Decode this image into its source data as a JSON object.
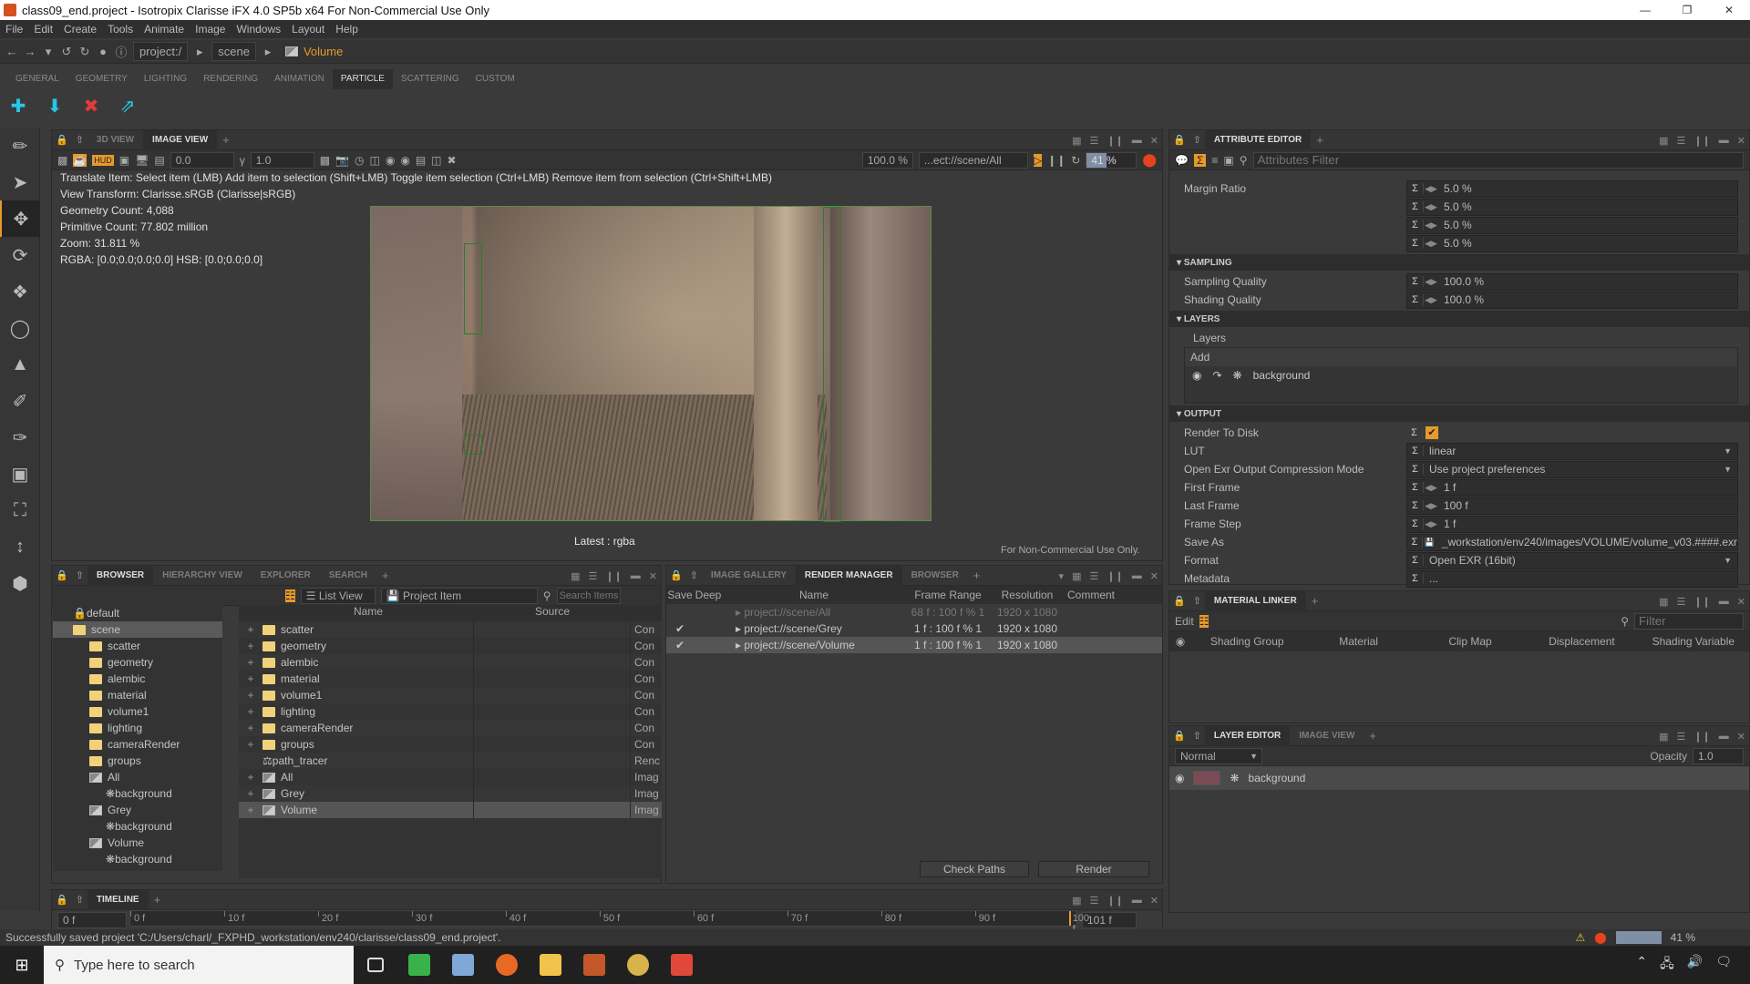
{
  "window": {
    "title": "class09_end.project - Isotropix Clarisse iFX 4.0 SP5b x64  For Non-Commercial Use Only",
    "controls": [
      "minimize",
      "maximize",
      "close"
    ]
  },
  "menu": [
    "File",
    "Edit",
    "Create",
    "Tools",
    "Animate",
    "Image",
    "Windows",
    "Layout",
    "Help"
  ],
  "breadcrumb": {
    "root": "project:/",
    "scene": "scene",
    "current": "Volume"
  },
  "shelf": {
    "tabs": [
      "GENERAL",
      "GEOMETRY",
      "LIGHTING",
      "RENDERING",
      "ANIMATION",
      "PARTICLE",
      "SCATTERING",
      "CUSTOM"
    ],
    "active_tab": "PARTICLE",
    "buttons": [
      "particle-add-icon",
      "particle-import-icon",
      "particle-remove-icon",
      "particle-scatter-icon"
    ]
  },
  "tools": [
    "eyedropper",
    "select",
    "translate",
    "rotate",
    "scale",
    "local-rotate",
    "stamp",
    "paint-scatter",
    "paint-list",
    "region-render",
    "frame-teapot",
    "measure",
    "color-swatch"
  ],
  "viewer": {
    "tabs": [
      "3D VIEW",
      "IMAGE VIEW"
    ],
    "active_tab": "IMAGE VIEW",
    "exposure": "0.0",
    "gamma": "1.0",
    "zoom_field": "100.0 %",
    "image_path": "...ect://scene/All",
    "progress": "41 %",
    "progress_value": 41,
    "hud": {
      "help": "Translate Item: Select item (LMB)  Add item to selection (Shift+LMB)  Toggle item selection (Ctrl+LMB)  Remove item from selection (Ctrl+Shift+LMB)",
      "view_transform": "View Transform: Clarisse.sRGB (Clarisse|sRGB)",
      "geometry_count": "Geometry Count: 4,088",
      "primitive_count": "Primitive Count: 77.802 million",
      "zoom": "Zoom: 31.811 %",
      "pixel": "RGBA: [0.0;0.0;0.0;0.0] HSB: [0.0;0.0;0.0]"
    },
    "latest_label": "Latest : rgba",
    "watermark": "For Non-Commercial Use Only."
  },
  "attribute_editor": {
    "tab": "ATTRIBUTE EDITOR",
    "filter_placeholder": "Attributes Filter",
    "margin_ratio": {
      "label": "Margin Ratio",
      "values": [
        "5.0 %",
        "5.0 %",
        "5.0 %",
        "5.0 %"
      ]
    },
    "sampling": {
      "header": "SAMPLING",
      "rows": [
        {
          "label": "Sampling Quality",
          "value": "100.0 %"
        },
        {
          "label": "Shading Quality",
          "value": "100.0 %"
        }
      ]
    },
    "layers": {
      "header": "LAYERS",
      "sub": "Layers",
      "add": "Add",
      "items": [
        "background"
      ]
    },
    "output": {
      "header": "OUTPUT",
      "render_to_disk": {
        "label": "Render To Disk",
        "checked": true
      },
      "lut": {
        "label": "LUT",
        "value": "linear"
      },
      "exr_mode": {
        "label": "Open Exr Output Compression Mode",
        "value": "Use project preferences"
      },
      "first_frame": {
        "label": "First Frame",
        "value": "1 f"
      },
      "last_frame": {
        "label": "Last Frame",
        "value": "100 f"
      },
      "frame_step": {
        "label": "Frame Step",
        "value": "1 f"
      },
      "save_as": {
        "label": "Save As",
        "value": "_workstation/env240/images/VOLUME/volume_v03.####.exr"
      },
      "format": {
        "label": "Format",
        "value": "Open EXR (16bit)"
      },
      "metadata": {
        "label": "Metadata",
        "value": "..."
      }
    }
  },
  "material_linker": {
    "tab": "MATERIAL LINKER",
    "edit": "Edit",
    "filter_placeholder": "Filter",
    "columns": [
      "Shading Group",
      "Material",
      "Clip Map",
      "Displacement",
      "Shading Variable"
    ]
  },
  "layer_editor": {
    "tabs": [
      "LAYER EDITOR",
      "IMAGE VIEW"
    ],
    "blend_mode": "Normal",
    "opacity_label": "Opacity",
    "opacity": "1.0",
    "layers": [
      "background"
    ]
  },
  "browser": {
    "tabs": [
      "BROWSER",
      "HIERARCHY VIEW",
      "EXPLORER",
      "SEARCH"
    ],
    "view_mode": "List View",
    "item_type": "Project Item",
    "search_placeholder": "Search Items",
    "tree": [
      {
        "label": "default",
        "depth": 0,
        "type": "locked"
      },
      {
        "label": "scene",
        "depth": 0,
        "type": "folder",
        "selected": true
      },
      {
        "label": "scatter",
        "depth": 1,
        "type": "folder"
      },
      {
        "label": "geometry",
        "depth": 1,
        "type": "folder"
      },
      {
        "label": "alembic",
        "depth": 1,
        "type": "folder"
      },
      {
        "label": "material",
        "depth": 1,
        "type": "folder"
      },
      {
        "label": "volume1",
        "depth": 1,
        "type": "folder"
      },
      {
        "label": "lighting",
        "depth": 1,
        "type": "folder"
      },
      {
        "label": "cameraRender",
        "depth": 1,
        "type": "folder"
      },
      {
        "label": "groups",
        "depth": 1,
        "type": "folder"
      },
      {
        "label": "All",
        "depth": 1,
        "type": "image"
      },
      {
        "label": "background",
        "depth": 2,
        "type": "layer"
      },
      {
        "label": "Grey",
        "depth": 1,
        "type": "image"
      },
      {
        "label": "background",
        "depth": 2,
        "type": "layer"
      },
      {
        "label": "Volume",
        "depth": 1,
        "type": "image"
      },
      {
        "label": "background",
        "depth": 2,
        "type": "layer"
      }
    ],
    "columns": [
      "Name",
      "Source"
    ],
    "items": [
      {
        "name": "scatter",
        "type": "Con",
        "icon": "folder"
      },
      {
        "name": "geometry",
        "type": "Con",
        "icon": "folder"
      },
      {
        "name": "alembic",
        "type": "Con",
        "icon": "folder"
      },
      {
        "name": "material",
        "type": "Con",
        "icon": "folder"
      },
      {
        "name": "volume1",
        "type": "Con",
        "icon": "folder"
      },
      {
        "name": "lighting",
        "type": "Con",
        "icon": "folder"
      },
      {
        "name": "cameraRender",
        "type": "Con",
        "icon": "folder"
      },
      {
        "name": "groups",
        "type": "Con",
        "icon": "folder"
      },
      {
        "name": "path_tracer",
        "type": "Renc",
        "icon": "renderer"
      },
      {
        "name": "All",
        "type": "Imag",
        "icon": "image"
      },
      {
        "name": "Grey",
        "type": "Imag",
        "icon": "image"
      },
      {
        "name": "Volume",
        "type": "Imag",
        "icon": "image",
        "selected": true
      }
    ]
  },
  "render_manager": {
    "tabs": [
      "IMAGE GALLERY",
      "RENDER MANAGER",
      "BROWSER"
    ],
    "active_tab": "RENDER MANAGER",
    "columns": [
      "Save",
      "Deep",
      "Name",
      "Frame Range",
      "Resolution",
      "Comment"
    ],
    "rows": [
      {
        "save": "",
        "name": "project://scene/All",
        "range": "68 f : 100 f % 1",
        "res": "1920 x 1080",
        "dim": true
      },
      {
        "save": "✔",
        "name": "project://scene/Grey",
        "range": "1 f : 100 f % 1",
        "res": "1920 x 1080"
      },
      {
        "save": "✔",
        "name": "project://scene/Volume",
        "range": "1 f : 100 f % 1",
        "res": "1920 x 1080",
        "selected": true
      }
    ],
    "check_paths": "Check Paths",
    "render": "Render"
  },
  "timeline": {
    "tab": "TIMELINE",
    "start": "0 f",
    "end": "101 f",
    "ticks": [
      "0 f",
      "10 f",
      "20 f",
      "30 f",
      "40 f",
      "50 f",
      "60 f",
      "70 f",
      "80 f",
      "90 f",
      "100 f"
    ],
    "current_frame": 100
  },
  "status": {
    "message": "Successfully saved project 'C:/Users/charl/_FXPHD_workstation/env240/clarisse/class09_end.project'.",
    "progress": "41 %"
  },
  "taskbar": {
    "search_placeholder": "Type here to search",
    "apps": [
      "task-view",
      "camtasia",
      "notepad",
      "firefox",
      "file-explorer",
      "clarisse",
      "utility",
      "camtasia-recorder"
    ]
  },
  "colors": {
    "accent": "#e69a2c",
    "panel": "#3a3a3a",
    "dark": "#2a2a2a",
    "bucket": "#2e7a2e",
    "shelf_icon": "#29c5e8"
  }
}
